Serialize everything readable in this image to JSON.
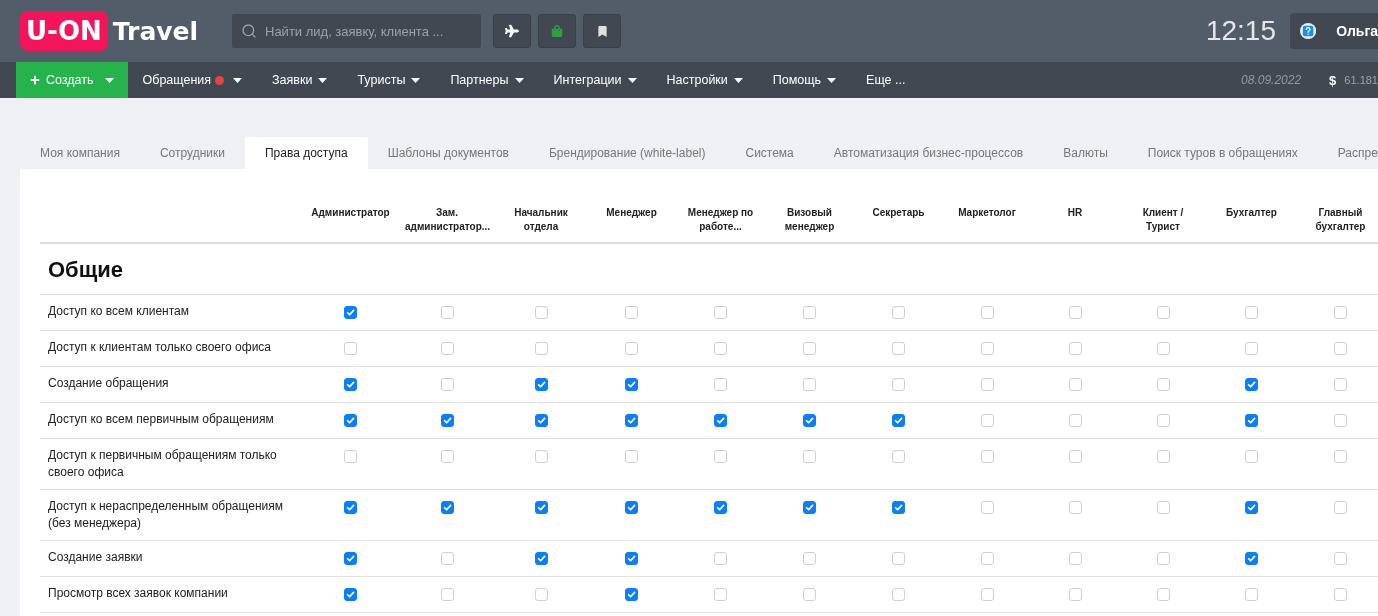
{
  "header": {
    "logo": {
      "badge": "U-ON",
      "text": "Travel"
    },
    "search": {
      "placeholder": "Найти лид, заявку, клиента ..."
    },
    "clock": "12:15",
    "user": {
      "name": "Ольга"
    }
  },
  "nav": {
    "create": {
      "label": "Создать",
      "menu": true
    },
    "items": [
      {
        "label": "Обращения",
        "alert": true,
        "menu": true
      },
      {
        "label": "Заявки",
        "alert": false,
        "menu": true
      },
      {
        "label": "Туристы",
        "alert": false,
        "menu": true
      },
      {
        "label": "Партнеры",
        "alert": false,
        "menu": true
      },
      {
        "label": "Интеграции",
        "alert": false,
        "menu": true
      },
      {
        "label": "Настройки",
        "alert": false,
        "menu": true
      },
      {
        "label": "Помощь",
        "alert": false,
        "menu": true
      },
      {
        "label": "Еще ...",
        "alert": false,
        "menu": false
      }
    ],
    "date": "08.09.2022",
    "currency": {
      "symbol": "$",
      "rate": "61.181"
    }
  },
  "tabs": [
    {
      "label": "Моя компания",
      "selected": false
    },
    {
      "label": "Сотрудники",
      "selected": false
    },
    {
      "label": "Права доступа",
      "selected": true
    },
    {
      "label": "Шаблоны документов",
      "selected": false
    },
    {
      "label": "Брендирование (white-label)",
      "selected": false
    },
    {
      "label": "Система",
      "selected": false
    },
    {
      "label": "Автоматизация бизнес-процессов",
      "selected": false
    },
    {
      "label": "Валюты",
      "selected": false
    },
    {
      "label": "Поиск туров в обращениях",
      "selected": false
    },
    {
      "label": "Распре",
      "selected": false
    }
  ],
  "table": {
    "columns": [
      "Администратор",
      "Зам. администратор...",
      "Начальник отдела",
      "Менеджер",
      "Менеджер по работе...",
      "Визовый менеджер",
      "Секретарь",
      "Маркетолог",
      "HR",
      "Клиент / Турист",
      "Бухгалтер",
      "Главный бухгалтер"
    ],
    "sections": [
      {
        "title": "Общие",
        "rows": [
          {
            "label": "Доступ ко всем клиентам",
            "checked": [
              true,
              false,
              false,
              false,
              false,
              false,
              false,
              false,
              false,
              false,
              false,
              false
            ]
          },
          {
            "label": "Доступ к клиентам только своего офиса",
            "checked": [
              false,
              false,
              false,
              false,
              false,
              false,
              false,
              false,
              false,
              false,
              false,
              false
            ]
          },
          {
            "label": "Создание обращения",
            "checked": [
              true,
              false,
              true,
              true,
              false,
              false,
              false,
              false,
              false,
              false,
              true,
              false
            ]
          },
          {
            "label": "Доступ ко всем первичным обращениям",
            "checked": [
              true,
              true,
              true,
              true,
              true,
              true,
              true,
              false,
              false,
              false,
              true,
              false
            ]
          },
          {
            "label": "Доступ к первичным обращениям только своего офиса",
            "checked": [
              false,
              false,
              false,
              false,
              false,
              false,
              false,
              false,
              false,
              false,
              false,
              false
            ]
          },
          {
            "label": "Доступ к нераспределенным обращениям (без менеджера)",
            "checked": [
              true,
              true,
              true,
              true,
              true,
              true,
              true,
              false,
              false,
              false,
              true,
              false
            ]
          },
          {
            "label": "Создание заявки",
            "checked": [
              true,
              false,
              true,
              true,
              false,
              false,
              false,
              false,
              false,
              false,
              true,
              false
            ]
          },
          {
            "label": "Просмотр всех заявок компании",
            "checked": [
              true,
              false,
              false,
              true,
              false,
              false,
              false,
              false,
              false,
              false,
              false,
              false
            ]
          }
        ]
      }
    ]
  }
}
